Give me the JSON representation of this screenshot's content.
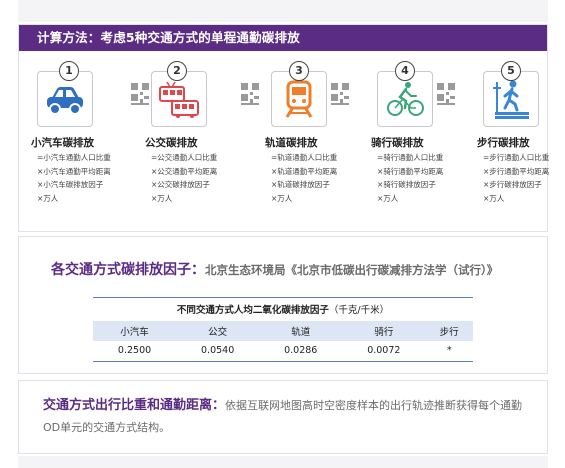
{
  "section1": {
    "header": "计算方法：考虑5种交通方式的单程通勤碳排放",
    "modes": [
      {
        "num": "1",
        "icon": "car-icon",
        "title": "小汽车碳排放",
        "lines": [
          "=小汽车通勤人口比重",
          "×小汽车通勤平均距离",
          "×小汽车碳排放因子",
          "×万人"
        ]
      },
      {
        "num": "2",
        "icon": "bus-icon",
        "title": "公交碳排放",
        "lines": [
          "=公交通勤人口比重",
          "×公交通勤平均距离",
          "×公交碳排放因子",
          "×万人"
        ]
      },
      {
        "num": "3",
        "icon": "train-icon",
        "title": "轨道碳排放",
        "lines": [
          "=轨道通勤人口比重",
          "×轨道通勤平均距离",
          "×轨道碳排放因子",
          "×万人"
        ]
      },
      {
        "num": "4",
        "icon": "bicycle-icon",
        "title": "骑行碳排放",
        "lines": [
          "=骑行通勤人口比重",
          "×骑行通勤平均距离",
          "×骑行碳排放因子",
          "×万人"
        ]
      },
      {
        "num": "5",
        "icon": "walking-icon",
        "title": "步行碳排放",
        "lines": [
          "=步行通勤人口比重",
          "×步行通勤平均距离",
          "×步行碳排放因子",
          "×万人"
        ]
      }
    ],
    "colors": {
      "header_bg": "#5b2c83",
      "car": "#2e6fc2",
      "bus": "#e0474c",
      "train": "#f07d2a",
      "bike": "#3aa57a",
      "walk": "#3a86d6"
    }
  },
  "section2": {
    "title": "各交通方式碳排放因子：",
    "source": "北京生态环境局《北京市低碳出行碳减排方法学（试行）》",
    "table_caption_bold": "不同交通方式人均二氧化碳排放因子",
    "table_caption_unit": "（千克/千米）",
    "columns": [
      "小汽车",
      "公交",
      "轨道",
      "骑行",
      "步行"
    ],
    "values": [
      "0.2500",
      "0.0540",
      "0.0286",
      "0.0072",
      "*"
    ]
  },
  "section3": {
    "title": "交通方式出行比重和通勤距离：",
    "text": "依据互联网地图高时空密度样本的出行轨迹推断获得每个通勤OD单元的交通方式结构。"
  }
}
